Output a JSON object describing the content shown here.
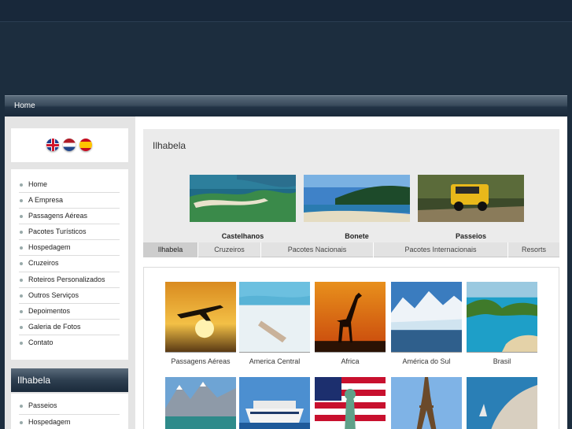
{
  "nav": {
    "home": "Home"
  },
  "flags": [
    "uk-flag-icon",
    "netherlands-flag-icon",
    "spain-flag-icon"
  ],
  "menu": [
    "Home",
    "A Empresa",
    "Passagens Aéreas",
    "Pacotes Turísticos",
    "Hospedagem",
    "Cruzeiros",
    "Roteiros Personalizados",
    "Outros Serviços",
    "Depoimentos",
    "Galeria de Fotos",
    "Contato"
  ],
  "section": {
    "title": "Ilhabela",
    "items": [
      "Passeios",
      "Hospedagem"
    ]
  },
  "feature": {
    "title": "Ilhabela",
    "thumbs": [
      "Castelhanos",
      "Bonete",
      "Passeios"
    ]
  },
  "tabs": [
    "Ilhabela",
    "Cruzeiros",
    "Pacotes Nacionais",
    "Pacotes Internacionais",
    "Resorts"
  ],
  "destinations": [
    "Passagens Aéreas",
    "America Central",
    "Africa",
    "América do Sul",
    "Brasil"
  ]
}
